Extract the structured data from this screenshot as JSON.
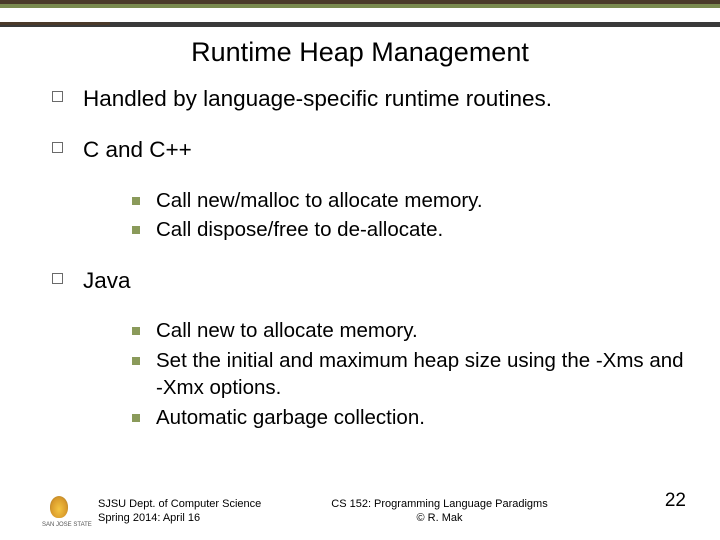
{
  "title": "Runtime Heap Management",
  "bullets": {
    "b0": {
      "text": "Handled by language-specific runtime routines."
    },
    "b1": {
      "text": "C and C++",
      "sub": {
        "s0": "Call new/malloc to allocate memory.",
        "s1": "Call dispose/free to de-allocate."
      }
    },
    "b2": {
      "text": "Java",
      "sub": {
        "s0": "Call new to allocate memory.",
        "s1": "Set the initial and maximum heap size using the -Xms and -Xmx options.",
        "s2": "Automatic garbage collection."
      }
    }
  },
  "footer": {
    "left_line1": "SJSU Dept. of Computer Science",
    "left_line2": "Spring 2014: April 16",
    "center_line1": "CS 152: Programming Language Paradigms",
    "center_line2": "© R. Mak",
    "page": "22",
    "logo_alt": "San Jose State University"
  }
}
